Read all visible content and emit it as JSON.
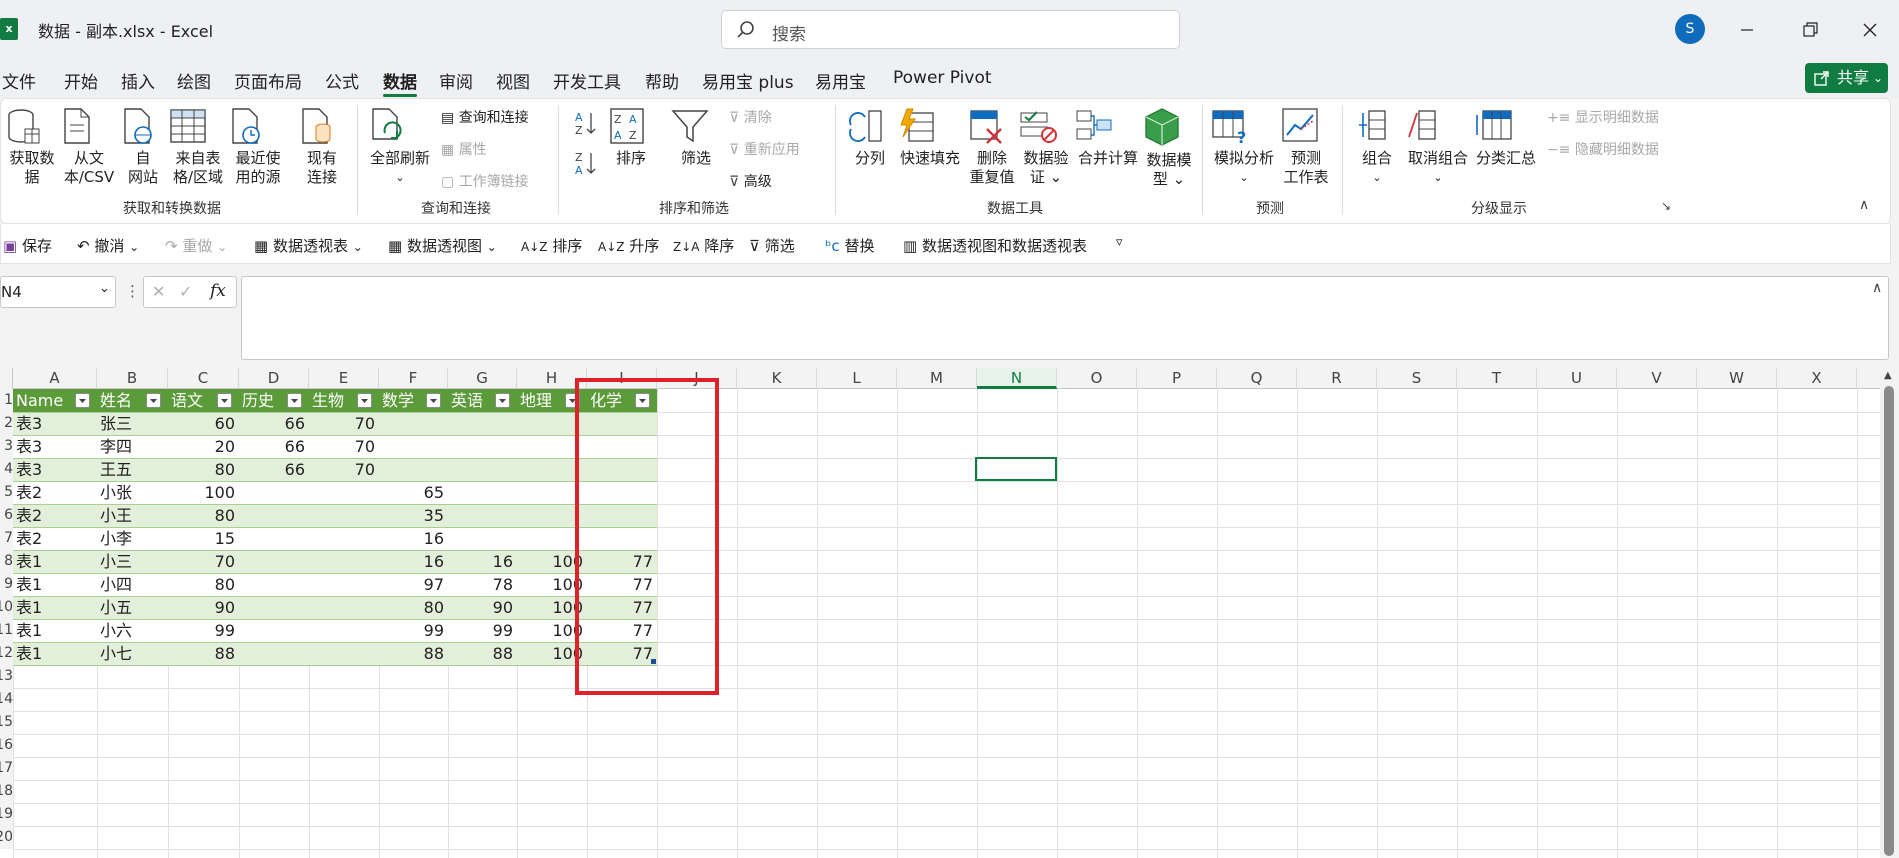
{
  "app": {
    "icon_letter": "x",
    "title": "数据 - 副本.xlsx  -  Excel"
  },
  "search": {
    "placeholder": "搜索"
  },
  "user": {
    "avatar_letter": "S"
  },
  "menu": {
    "items": [
      "文件",
      "开始",
      "插入",
      "绘图",
      "页面布局",
      "公式",
      "数据",
      "审阅",
      "视图",
      "开发工具",
      "帮助",
      "易用宝 plus",
      "易用宝",
      "Power Pivot"
    ],
    "active": "数据",
    "share_label": "共享"
  },
  "ribbon": {
    "get_data": {
      "label1": "获取数",
      "label2": "据",
      "group": "获取和转换数据"
    },
    "from_csv": {
      "label1": "从文",
      "label2": "本/CSV"
    },
    "from_web": {
      "label1": "自",
      "label2": "网站"
    },
    "from_table": {
      "label1": "来自表",
      "label2": "格/区域"
    },
    "recent_sources": {
      "label1": "最近使",
      "label2": "用的源"
    },
    "existing_conn": {
      "label1": "现有",
      "label2": "连接"
    },
    "refresh_all": {
      "label": "全部刷新"
    },
    "queries_connections": "查询和连接",
    "properties": "属性",
    "workbook_links": "工作簿链接",
    "group_queries": "查询和连接",
    "sort": "排序",
    "filter": "筛选",
    "clear": "清除",
    "reapply": "重新应用",
    "advanced": "高级",
    "group_sort": "排序和筛选",
    "text_to_columns": "分列",
    "flash_fill": "快速填充",
    "remove_dup": {
      "label1": "删除",
      "label2": "重复值"
    },
    "data_validation": {
      "label1": "数据验",
      "label2": "证"
    },
    "consolidate": "合并计算",
    "data_model": {
      "label1": "数据模",
      "label2": "型"
    },
    "group_tools": "数据工具",
    "what_if": "模拟分析",
    "forecast": {
      "label1": "预测",
      "label2": "工作表"
    },
    "group_forecast": "预测",
    "group_btn": "组合",
    "ungroup_btn": "取消组合",
    "subtotal": "分类汇总",
    "show_detail": "显示明细数据",
    "hide_detail": "隐藏明细数据",
    "group_outline": "分级显示"
  },
  "qat": {
    "save": "保存",
    "undo": "撤消",
    "redo": "重做",
    "pivot_table": "数据透视表",
    "pivot_view": "数据透视图",
    "sort": "排序",
    "sort_asc": "升序",
    "sort_desc": "降序",
    "filter": "筛选",
    "replace": "替换",
    "pivot_both": "数据透视图和数据透视表"
  },
  "formula_bar": {
    "name_box": "N4",
    "formula": ""
  },
  "sheet": {
    "columns": [
      "A",
      "B",
      "C",
      "D",
      "E",
      "F",
      "G",
      "H",
      "I",
      "J",
      "K",
      "L",
      "M",
      "N",
      "O",
      "P",
      "Q",
      "R",
      "S",
      "T",
      "U",
      "V",
      "W",
      "X"
    ],
    "selected_column": "N",
    "row_numbers": [
      "1",
      "2",
      "3",
      "4",
      "5",
      "6",
      "7",
      "8",
      "9",
      "10",
      "11",
      "12",
      "13",
      "14",
      "15",
      "16",
      "17",
      "18",
      "19",
      "20"
    ],
    "table_headers": [
      "Name",
      "姓名",
      "语文",
      "历史",
      "生物",
      "数学",
      "英语",
      "地理",
      "化学"
    ],
    "rows": [
      [
        "表3",
        "张三",
        "60",
        "66",
        "70",
        "",
        "",
        "",
        ""
      ],
      [
        "表3",
        "李四",
        "20",
        "66",
        "70",
        "",
        "",
        "",
        ""
      ],
      [
        "表3",
        "王五",
        "80",
        "66",
        "70",
        "",
        "",
        "",
        ""
      ],
      [
        "表2",
        "小张",
        "100",
        "",
        "",
        "65",
        "",
        "",
        ""
      ],
      [
        "表2",
        "小王",
        "80",
        "",
        "",
        "35",
        "",
        "",
        ""
      ],
      [
        "表2",
        "小李",
        "15",
        "",
        "",
        "16",
        "",
        "",
        ""
      ],
      [
        "表1",
        "小三",
        "70",
        "",
        "",
        "16",
        "16",
        "100",
        "77"
      ],
      [
        "表1",
        "小四",
        "80",
        "",
        "",
        "97",
        "78",
        "100",
        "77"
      ],
      [
        "表1",
        "小五",
        "90",
        "",
        "",
        "80",
        "90",
        "100",
        "77"
      ],
      [
        "表1",
        "小六",
        "99",
        "",
        "",
        "99",
        "99",
        "100",
        "77"
      ],
      [
        "表1",
        "小七",
        "88",
        "",
        "",
        "88",
        "88",
        "100",
        "77"
      ]
    ]
  },
  "colors": {
    "accent": "#107c41",
    "table_header": "#5b9b3a",
    "band": "#e2efda",
    "highlight_box": "#e0202a"
  }
}
